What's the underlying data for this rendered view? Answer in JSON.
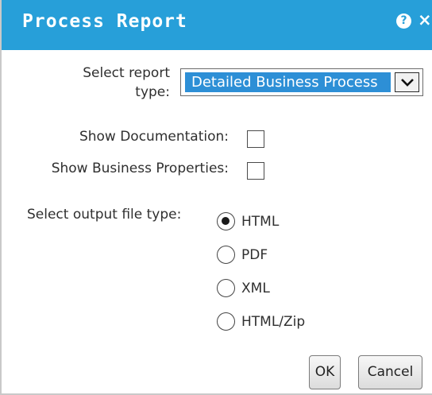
{
  "dialog": {
    "title": "Process Report",
    "help_icon": "?",
    "close_icon": "×"
  },
  "report_type": {
    "label": "Select report type:",
    "selected": "Detailed Business Process",
    "arrow_icon": "chevron-down-icon"
  },
  "options": {
    "show_documentation": {
      "label": "Show Documentation:",
      "checked": false
    },
    "show_business_properties": {
      "label": "Show Business Properties:",
      "checked": false
    }
  },
  "output": {
    "label": "Select output file type:",
    "choices": [
      {
        "label": "HTML",
        "selected": true
      },
      {
        "label": "PDF",
        "selected": false
      },
      {
        "label": "XML",
        "selected": false
      },
      {
        "label": "HTML/Zip",
        "selected": false
      }
    ]
  },
  "buttons": {
    "ok": "OK",
    "cancel": "Cancel"
  },
  "colors": {
    "titlebar": "#279fd9",
    "selection": "#2d8fd6"
  }
}
